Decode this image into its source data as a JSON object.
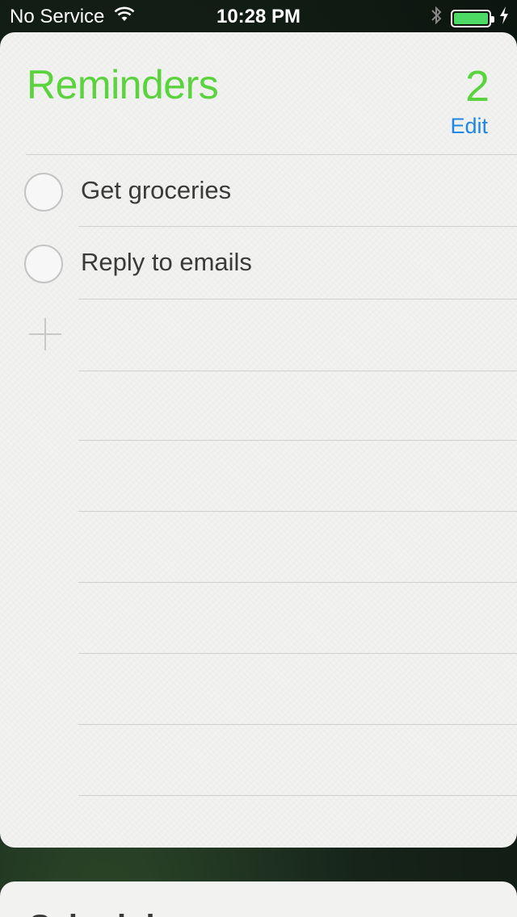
{
  "status_bar": {
    "carrier": "No Service",
    "time": "10:28 PM",
    "battery_level": 1.0,
    "icons": [
      "wifi-icon",
      "bluetooth-icon",
      "battery-icon",
      "charging-bolt-icon"
    ]
  },
  "reminders": {
    "title": "Reminders",
    "count": "2",
    "edit_label": "Edit",
    "items": [
      {
        "label": "Get groceries",
        "completed": false
      },
      {
        "label": "Reply to emails",
        "completed": false
      }
    ],
    "add_icon": "plus-icon"
  },
  "next_card": {
    "title": "Schedule"
  },
  "colors": {
    "accent_green": "#5ad33e",
    "link_blue": "#1f87e0",
    "battery_green": "#4cd964"
  }
}
